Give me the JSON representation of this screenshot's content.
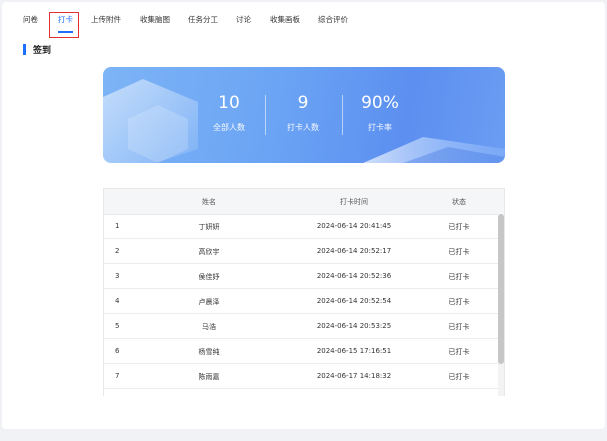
{
  "tabs": [
    {
      "label": "问卷"
    },
    {
      "label": "打卡"
    },
    {
      "label": "上传附件"
    },
    {
      "label": "收集脑图"
    },
    {
      "label": "任务分工"
    },
    {
      "label": "讨论"
    },
    {
      "label": "收集画板"
    },
    {
      "label": "综合评价"
    }
  ],
  "active_tab": "打卡",
  "section_title": "签到",
  "stats": {
    "total": {
      "value": "10",
      "label": "全部人数"
    },
    "checked": {
      "value": "9",
      "label": "打卡人数"
    },
    "rate": {
      "value": "90%",
      "label": "打卡率"
    }
  },
  "table": {
    "headers": {
      "name": "姓名",
      "time": "打卡时间",
      "status": "状态"
    },
    "rows": [
      {
        "idx": "1",
        "name": "丁妍妍",
        "time": "2024-06-14 20:41:45",
        "status": "已打卡"
      },
      {
        "idx": "2",
        "name": "高欣宇",
        "time": "2024-06-14 20:52:17",
        "status": "已打卡"
      },
      {
        "idx": "3",
        "name": "侯佳妤",
        "time": "2024-06-14 20:52:36",
        "status": "已打卡"
      },
      {
        "idx": "4",
        "name": "卢晨泽",
        "time": "2024-06-14 20:52:54",
        "status": "已打卡"
      },
      {
        "idx": "5",
        "name": "马浩",
        "time": "2024-06-14 20:53:25",
        "status": "已打卡"
      },
      {
        "idx": "6",
        "name": "杨雪纯",
        "time": "2024-06-15 17:16:51",
        "status": "已打卡"
      },
      {
        "idx": "7",
        "name": "陈雨嘉",
        "time": "2024-06-17 14:18:32",
        "status": "已打卡"
      }
    ]
  },
  "colors": {
    "accent": "#1e6fff",
    "highlight": "#e03131"
  }
}
